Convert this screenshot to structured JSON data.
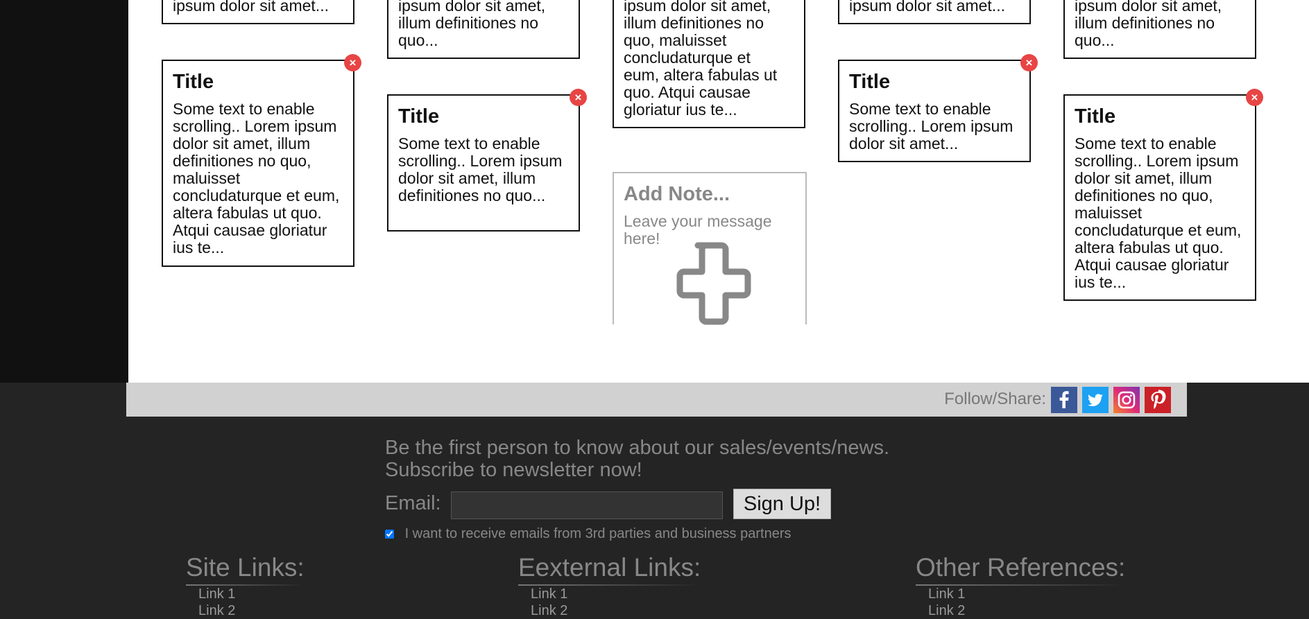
{
  "notes": {
    "close_glyph": "×",
    "top_fragments": [
      "ipsum dolor sit amet...",
      "ipsum dolor sit amet,\nillum definitiones no\nquo...",
      "ipsum dolor sit amet,\nillum definitiones no\nquo, maluisset\nconcludaturque et\neum, altera fabulas ut\nquo. Atqui causae\ngloriatur ius te...",
      "ipsum dolor sit amet...",
      "ipsum dolor sit amet,\nillum definitiones no\nquo..."
    ],
    "cards": [
      {
        "title": "Title",
        "text": "Some text to enable scrolling.. Lorem ipsum dolor sit amet, illum definitiones no quo, maluisset concludaturque et eum, altera fabulas ut quo. Atqui causae gloriatur ius te..."
      },
      {
        "title": "Title",
        "text": "Some text to enable scrolling.. Lorem ipsum dolor sit amet, illum definitiones no quo..."
      },
      {
        "title": "Title",
        "text": "Some text to enable scrolling.. Lorem ipsum dolor sit amet..."
      },
      {
        "title": "Title",
        "text": "Some text to enable scrolling.. Lorem ipsum dolor sit amet, illum definitiones no quo, maluisset concludaturque et eum, altera fabulas ut quo. Atqui causae gloriatur ius te..."
      }
    ],
    "add_note": {
      "title": "Add Note...",
      "placeholder": "Leave your message here!"
    }
  },
  "follow": {
    "label": "Follow/Share:",
    "icons": [
      {
        "name": "facebook-icon",
        "color": "#3b5998"
      },
      {
        "name": "twitter-icon",
        "color": "#1da1f2"
      },
      {
        "name": "instagram-icon",
        "color": "#c13584"
      },
      {
        "name": "pinterest-icon",
        "color": "#cb2027"
      }
    ]
  },
  "newsletter": {
    "line1": "Be the first person to know about our sales/events/news.",
    "line2": "Subscribe to newsletter now!",
    "email_label": "Email:",
    "email_value": "",
    "signup_label": "Sign Up!",
    "consent_label": "I want to receive emails from 3rd parties and business partners",
    "consent_checked": true
  },
  "footer": {
    "columns": [
      {
        "title": "Site Links:",
        "links": [
          "Link 1",
          "Link 2"
        ]
      },
      {
        "title": "Eexternal Links:",
        "links": [
          "Link 1",
          "Link 2"
        ]
      },
      {
        "title": "Other References:",
        "links": [
          "Link 1",
          "Link 2"
        ]
      }
    ]
  }
}
